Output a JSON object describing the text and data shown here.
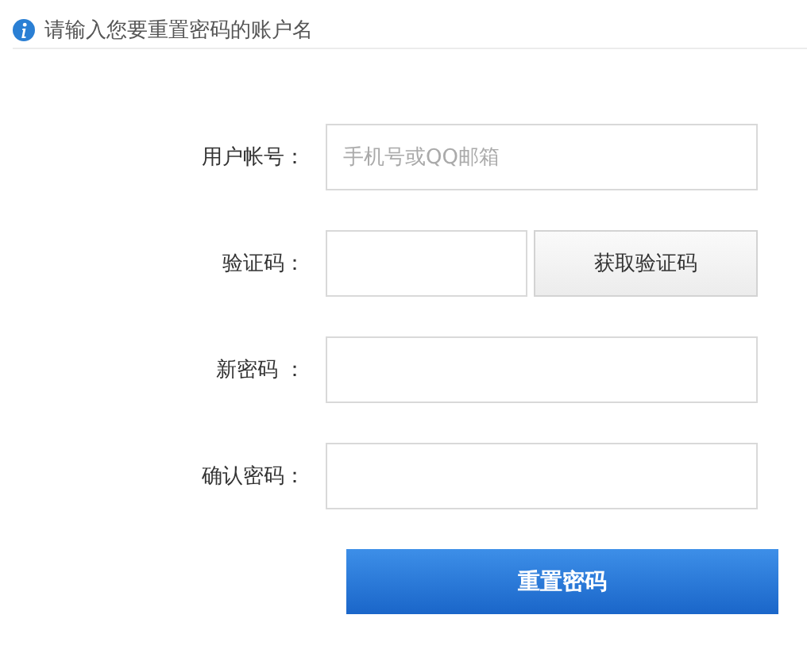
{
  "notice": {
    "text": "请输入您要重置密码的账户名"
  },
  "fields": [
    {
      "kind": "text",
      "label": "用户帐号：",
      "placeholder": "手机号或QQ邮箱"
    },
    {
      "kind": "code",
      "label": "验证码：",
      "button": "获取验证码"
    },
    {
      "kind": "text",
      "label": "新密码 ："
    },
    {
      "kind": "text",
      "label": "确认密码："
    }
  ],
  "submit": "重置密码"
}
